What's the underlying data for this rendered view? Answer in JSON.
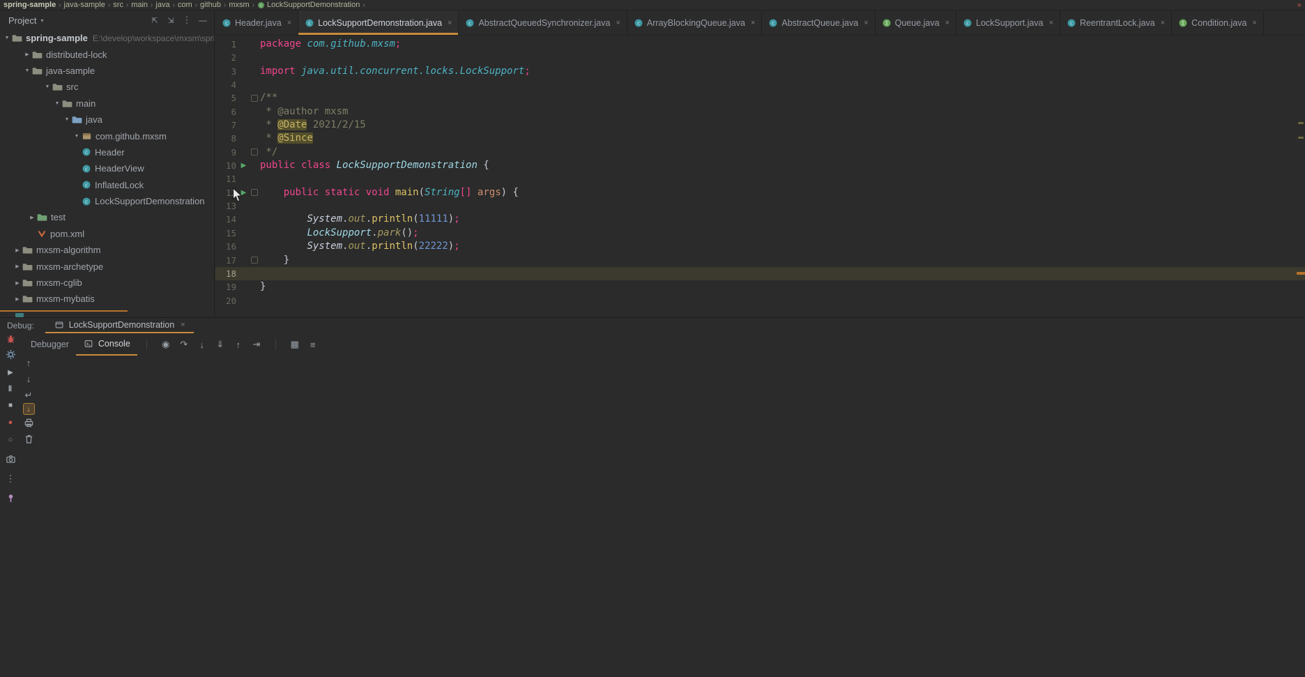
{
  "accents": {
    "active_tab_underline": "#c98a3d",
    "run_icon_green": "#59a869",
    "error_red": "#c75450",
    "caret_line_highlight": "#3c3a2e"
  },
  "window": {
    "close_glyph": "×"
  },
  "breadcrumb_bar": {
    "separator": "›",
    "items": [
      "spring-sample",
      "java-sample",
      "src",
      "main",
      "java",
      "com",
      "github",
      "mxsm",
      "LockSupportDemonstration"
    ]
  },
  "project_panel": {
    "header": {
      "title": "Project",
      "chevron": "▾",
      "icons": [
        {
          "name": "expand-icon"
        },
        {
          "name": "collapse-icon"
        },
        {
          "name": "more-options-icon"
        },
        {
          "name": "hide-panel-icon"
        }
      ]
    },
    "tree": [
      {
        "label": "spring-sample",
        "suffix": "E:\\develop\\workspace\\mxsm\\spring-sa",
        "icon": "folder",
        "chevron": "expanded",
        "indent": 4,
        "bold": true
      },
      {
        "label": "distributed-lock",
        "icon": "folder",
        "chevron": "collapsed",
        "indent": 33
      },
      {
        "label": "java-sample",
        "icon": "folder",
        "chevron": "expanded",
        "indent": 33
      },
      {
        "label": "src",
        "icon": "folder-src",
        "chevron": "expanded",
        "indent": 62
      },
      {
        "label": "main",
        "icon": "folder",
        "chevron": "expanded",
        "indent": 76
      },
      {
        "label": "java",
        "icon": "folder-java",
        "chevron": "expanded",
        "indent": 90
      },
      {
        "label": "com.github.mxsm",
        "icon": "package",
        "chevron": "expanded",
        "indent": 104
      },
      {
        "label": "Header",
        "icon": "class",
        "indent": 104
      },
      {
        "label": "HeaderView",
        "icon": "class",
        "indent": 104
      },
      {
        "label": "InflatedLock",
        "icon": "class",
        "indent": 104
      },
      {
        "label": "LockSupportDemonstration",
        "icon": "class",
        "indent": 104
      },
      {
        "label": "test",
        "icon": "folder-test",
        "chevron": "collapsed",
        "indent": 40
      },
      {
        "label": "pom.xml",
        "icon": "maven",
        "indent": 40
      },
      {
        "label": "mxsm-algorithm",
        "icon": "folder",
        "chevron": "collapsed",
        "indent": 19
      },
      {
        "label": "mxsm-archetype",
        "icon": "folder",
        "chevron": "collapsed",
        "indent": 19
      },
      {
        "label": "mxsm-cglib",
        "icon": "folder",
        "chevron": "collapsed",
        "indent": 19
      },
      {
        "label": "mxsm-mybatis",
        "icon": "folder",
        "chevron": "collapsed",
        "indent": 19
      }
    ]
  },
  "editor": {
    "tab_close": "×",
    "tabs": [
      {
        "label": "Header.java",
        "icon": "class"
      },
      {
        "label": "LockSupportDemonstration.java",
        "icon": "class",
        "active": true
      },
      {
        "label": "AbstractQueuedSynchronizer.java",
        "icon": "class"
      },
      {
        "label": "ArrayBlockingQueue.java",
        "icon": "class"
      },
      {
        "label": "AbstractQueue.java",
        "icon": "class"
      },
      {
        "label": "Queue.java",
        "icon": "interface"
      },
      {
        "label": "LockSupport.java",
        "icon": "class"
      },
      {
        "label": "ReentrantLock.java",
        "icon": "class"
      },
      {
        "label": "Condition.java",
        "icon": "interface"
      }
    ],
    "code": {
      "lines": [
        {
          "num": 1,
          "tokens": [
            {
              "t": "package ",
              "c": "kw"
            },
            {
              "t": "com.github.mxsm",
              "c": "ns"
            },
            {
              "t": ";",
              "c": "kw"
            }
          ]
        },
        {
          "num": 2,
          "tokens": []
        },
        {
          "num": 3,
          "tokens": [
            {
              "t": "import ",
              "c": "kw"
            },
            {
              "t": "java.util.concurrent.locks.LockSupport",
              "c": "ns"
            },
            {
              "t": ";",
              "c": "kw"
            }
          ]
        },
        {
          "num": 4,
          "tokens": []
        },
        {
          "num": 5,
          "fold": "start",
          "tokens": [
            {
              "t": "/**",
              "c": "cm"
            }
          ]
        },
        {
          "num": 6,
          "tokens": [
            {
              "t": " * @author mxsm",
              "c": "cm"
            }
          ]
        },
        {
          "num": 7,
          "tokens": [
            {
              "t": " * ",
              "c": "cm"
            },
            {
              "t": "@Date",
              "c": "cmh"
            },
            {
              "t": " 2021/2/15",
              "c": "cm"
            }
          ]
        },
        {
          "num": 8,
          "tokens": [
            {
              "t": " * ",
              "c": "cm"
            },
            {
              "t": "@Since",
              "c": "cmh"
            }
          ]
        },
        {
          "num": 9,
          "fold": "end",
          "tokens": [
            {
              "t": " */",
              "c": "cm"
            }
          ]
        },
        {
          "num": 10,
          "run": true,
          "tokens": [
            {
              "t": "public class ",
              "c": "kw"
            },
            {
              "t": "LockSupportDemonstration",
              "c": "cls"
            },
            {
              "t": " {",
              "c": "pl"
            }
          ]
        },
        {
          "num": 11,
          "tokens": []
        },
        {
          "num": 12,
          "run": true,
          "fold": "start",
          "tokens": [
            {
              "t": "    ",
              "c": "pl"
            },
            {
              "t": "public static void ",
              "c": "kw"
            },
            {
              "t": "main",
              "c": "fn"
            },
            {
              "t": "(",
              "c": "pl"
            },
            {
              "t": "String",
              "c": "ns"
            },
            {
              "t": "[] ",
              "c": "kw"
            },
            {
              "t": "args",
              "c": "arg"
            },
            {
              "t": ") {",
              "c": "pl"
            }
          ]
        },
        {
          "num": 13,
          "tokens": []
        },
        {
          "num": 14,
          "tokens": [
            {
              "t": "        ",
              "c": "pl"
            },
            {
              "t": "System",
              "c": "sys"
            },
            {
              "t": ".",
              "c": "pl"
            },
            {
              "t": "out",
              "c": "fld"
            },
            {
              "t": ".",
              "c": "pl"
            },
            {
              "t": "println",
              "c": "fn"
            },
            {
              "t": "(",
              "c": "pl"
            },
            {
              "t": "11111",
              "c": "num"
            },
            {
              "t": ")",
              "c": "pl"
            },
            {
              "t": ";",
              "c": "kw"
            }
          ]
        },
        {
          "num": 15,
          "tokens": [
            {
              "t": "        ",
              "c": "pl"
            },
            {
              "t": "LockSupport",
              "c": "cls"
            },
            {
              "t": ".",
              "c": "pl"
            },
            {
              "t": "park",
              "c": "fld"
            },
            {
              "t": "()",
              "c": "pl"
            },
            {
              "t": ";",
              "c": "kw"
            }
          ]
        },
        {
          "num": 16,
          "tokens": [
            {
              "t": "        ",
              "c": "pl"
            },
            {
              "t": "System",
              "c": "sys"
            },
            {
              "t": ".",
              "c": "pl"
            },
            {
              "t": "out",
              "c": "fld"
            },
            {
              "t": ".",
              "c": "pl"
            },
            {
              "t": "println",
              "c": "fn"
            },
            {
              "t": "(",
              "c": "pl"
            },
            {
              "t": "22222",
              "c": "num"
            },
            {
              "t": ")",
              "c": "pl"
            },
            {
              "t": ";",
              "c": "kw"
            }
          ]
        },
        {
          "num": 17,
          "fold": "end",
          "tokens": [
            {
              "t": "    }",
              "c": "pl"
            }
          ]
        },
        {
          "num": 18,
          "current": true,
          "tokens": []
        },
        {
          "num": 19,
          "tokens": [
            {
              "t": "}",
              "c": "pl"
            }
          ]
        },
        {
          "num": 20,
          "tokens": []
        }
      ]
    }
  },
  "debug_panel": {
    "label": "Debug:",
    "session_tab": {
      "label": "LockSupportDemonstration",
      "close": "×"
    },
    "tabs": [
      {
        "label": "Debugger",
        "active": false
      },
      {
        "label": "Console",
        "active": true,
        "icon": "console-icon"
      }
    ],
    "toolbar_icons": [
      {
        "name": "separator"
      },
      {
        "name": "execution-point-icon"
      },
      {
        "name": "step-over-icon"
      },
      {
        "name": "step-into-icon"
      },
      {
        "name": "force-step-into-icon"
      },
      {
        "name": "step-out-icon"
      },
      {
        "name": "run-to-cursor-icon"
      },
      {
        "name": "separator"
      },
      {
        "name": "restore-layout-icon"
      },
      {
        "name": "layout-settings-icon"
      }
    ],
    "left_toolbar": [
      {
        "name": "rerun-debugger-icon"
      },
      {
        "name": "settings-gear-icon"
      },
      {
        "name": "resume-icon"
      },
      {
        "name": "pause-icon"
      },
      {
        "name": "stop-icon"
      },
      {
        "name": "view-breakpoints-icon"
      },
      {
        "name": "mute-breakpoints-icon"
      },
      {
        "name": "thread-dump-icon"
      },
      {
        "name": "more-icon"
      },
      {
        "name": "pin-icon"
      }
    ],
    "console_toolbar": [
      {
        "name": "scroll-up-icon"
      },
      {
        "name": "scroll-down-icon"
      },
      {
        "name": "soft-wrap-icon"
      },
      {
        "name": "scroll-to-end-icon"
      },
      {
        "name": "print-icon"
      },
      {
        "name": "clear-console-icon"
      }
    ]
  }
}
